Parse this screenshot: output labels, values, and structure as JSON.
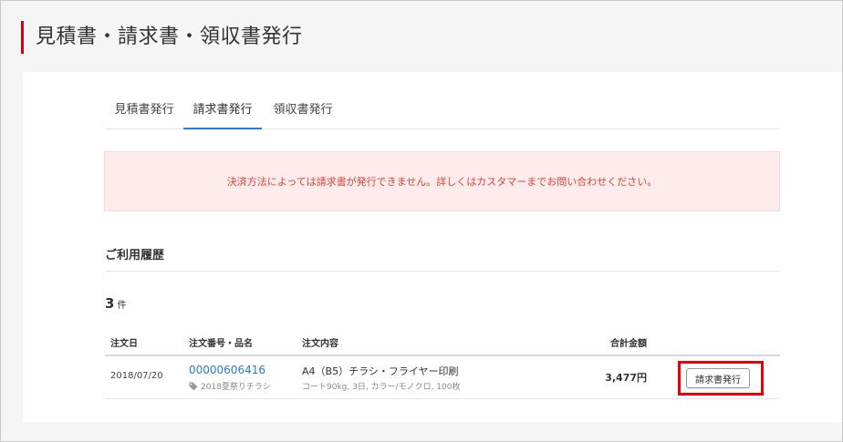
{
  "header": {
    "title": "見積書・請求書・領収書発行"
  },
  "tabs": [
    {
      "label": "見積書発行",
      "active": false
    },
    {
      "label": "請求書発行",
      "active": true
    },
    {
      "label": "領収書発行",
      "active": false
    }
  ],
  "alert": {
    "message": "決済方法によっては請求書が発行できません。詳しくはカスタマーまでお問い合わせください。"
  },
  "history": {
    "title": "ご利用履歴",
    "count": "3",
    "count_unit": "件",
    "columns": {
      "date": "注文日",
      "order": "注文番号・品名",
      "content": "注文内容",
      "total": "合計金額"
    },
    "rows": [
      {
        "date": "2018/07/20",
        "order_no": "00000606416",
        "item_name": "2018夏祭りチラシ",
        "content_main": "A4（B5）チラシ・フライヤー印刷",
        "content_sub": "コート90kg, 3日, カラー/モノクロ, 100枚",
        "total": "3,477円",
        "button_label": "請求書発行"
      }
    ]
  },
  "colors": {
    "accent_red": "#d0021b",
    "tab_active": "#2a7dd6",
    "link": "#2a7dd6",
    "alert_bg": "#fdeceb",
    "alert_text": "#e0453a",
    "highlight": "#e8000b"
  }
}
